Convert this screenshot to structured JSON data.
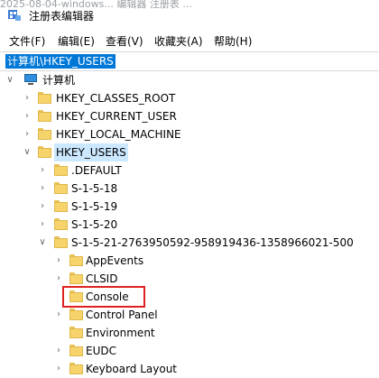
{
  "window": {
    "title": "注册表编辑器",
    "background_text": "2025-08-04-windows... 编辑器 注册表 ..."
  },
  "menu": [
    "文件(F)",
    "编辑(E)",
    "查看(V)",
    "收藏夹(A)",
    "帮助(H)"
  ],
  "address": "计算机\\HKEY_USERS",
  "tree": {
    "root": "计算机",
    "hives": [
      "HKEY_CLASSES_ROOT",
      "HKEY_CURRENT_USER",
      "HKEY_LOCAL_MACHINE",
      "HKEY_USERS"
    ],
    "users_children": [
      ".DEFAULT",
      "S-1-5-18",
      "S-1-5-19",
      "S-1-5-20",
      "S-1-5-21-2763950592-958919436-1358966021-500"
    ],
    "sid_children": [
      "AppEvents",
      "CLSID",
      "Console",
      "Control Panel",
      "Environment",
      "EUDC",
      "Keyboard Layout"
    ]
  },
  "colors": {
    "selection": "#0078d7",
    "highlight_box": "#e02020",
    "folder": "#f6d36b"
  }
}
